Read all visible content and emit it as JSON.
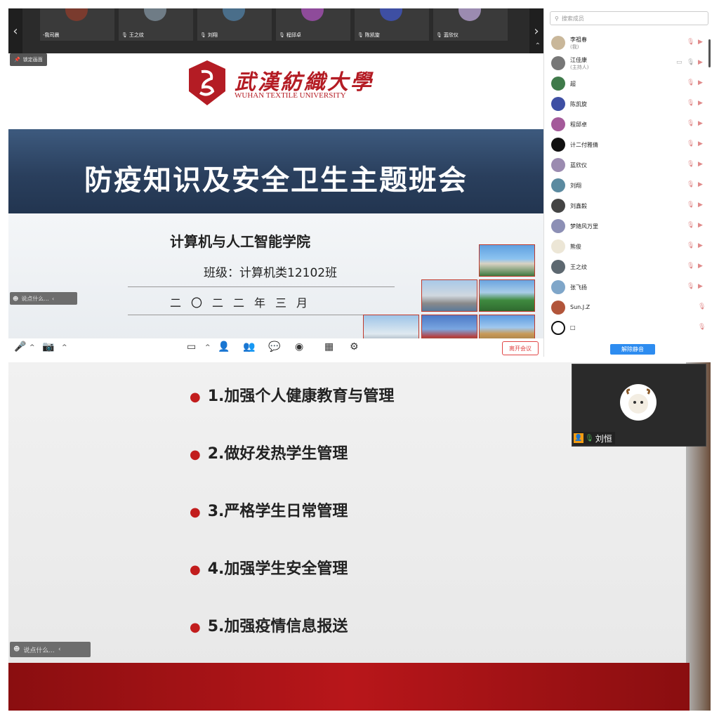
{
  "video_strip": {
    "prev": "‹",
    "next": "›",
    "collapse": "⌃",
    "tiles": [
      {
        "name": "-我司晨",
        "color": "#7a3b2e"
      },
      {
        "name": "王之纹",
        "color": "#6f7c86"
      },
      {
        "name": "刘翔",
        "color": "#4a6e8a"
      },
      {
        "name": "程邱卓",
        "color": "#8e4b9a"
      },
      {
        "name": "陈凯旋",
        "color": "#3e4fa3"
      },
      {
        "name": "蓝欣仪",
        "color": "#9b8bb0"
      }
    ]
  },
  "lock_label": "锁定画面",
  "slide1": {
    "uni_cn": "武漢紡織大學",
    "uni_en": "WUHAN TEXTILE UNIVERSITY",
    "title": "防疫知识及安全卫生主题班会",
    "college": "计算机与人工智能学院",
    "class_line": "班级：计算机类12102班",
    "date_line": "二〇二二年三月"
  },
  "chat_placeholder": "说点什么...",
  "toolbar": {
    "leave": "离开会议"
  },
  "participants": {
    "search_placeholder": "搜索成员",
    "unmute_all": "解除静音",
    "list": [
      {
        "name": "李祖春",
        "sub": "(我)",
        "color": "#c9b79a"
      },
      {
        "name": "江佳康",
        "sub": "(主持人)",
        "color": "#777777"
      },
      {
        "name": "超",
        "sub": "",
        "color": "#3f7a4a"
      },
      {
        "name": "陈凯旋",
        "sub": "",
        "color": "#3e4fa3"
      },
      {
        "name": "程邱卓",
        "sub": "",
        "color": "#a45a9a"
      },
      {
        "name": "计二付雅倩",
        "sub": "",
        "color": "#111111"
      },
      {
        "name": "蓝欣仪",
        "sub": "",
        "color": "#9b8bb0"
      },
      {
        "name": "刘翔",
        "sub": "",
        "color": "#5b8aa0"
      },
      {
        "name": "刘鑫毅",
        "sub": "",
        "color": "#444444"
      },
      {
        "name": "梦随风万里",
        "sub": "",
        "color": "#8c8fb5"
      },
      {
        "name": "熊俊",
        "sub": "",
        "color": "#ece6d6"
      },
      {
        "name": "王之纹",
        "sub": "",
        "color": "#5d6870"
      },
      {
        "name": "张飞扬",
        "sub": "",
        "color": "#7fa6c9"
      },
      {
        "name": "Sun.J.Z",
        "sub": "",
        "color": "#b2553a"
      },
      {
        "name": "□",
        "sub": "",
        "color": "#ffffff"
      }
    ]
  },
  "slide2": {
    "items": [
      "1.加强个人健康教育与管理",
      "2.做好发热学生管理",
      "3.严格学生日常管理",
      "4.加强学生安全管理",
      "5.加强疫情信息报送"
    ]
  },
  "pip": {
    "name": "刘恒"
  }
}
